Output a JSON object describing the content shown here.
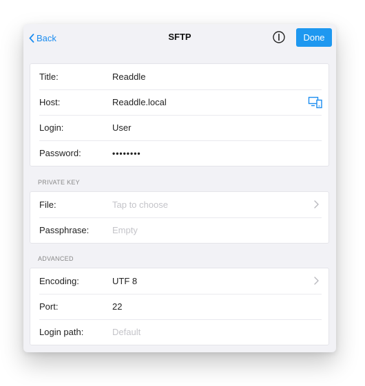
{
  "navbar": {
    "back_label": "Back",
    "title": "SFTP",
    "done_label": "Done",
    "accent_color": "#1e98f0"
  },
  "connection": {
    "title_label": "Title:",
    "title_value": "Readdle",
    "host_label": "Host:",
    "host_value": "Readdle.local",
    "login_label": "Login:",
    "login_value": "User",
    "password_label": "Password:",
    "password_value": "••••••••"
  },
  "private_key": {
    "header": "PRIVATE KEY",
    "file_label": "File:",
    "file_placeholder": "Tap to choose",
    "passphrase_label": "Passphrase:",
    "passphrase_placeholder": "Empty"
  },
  "advanced": {
    "header": "ADVANCED",
    "encoding_label": "Encoding:",
    "encoding_value": "UTF 8",
    "port_label": "Port:",
    "port_value": "22",
    "login_path_label": "Login path:",
    "login_path_placeholder": "Default"
  },
  "icons": {
    "back": "chevron-left-icon",
    "info": "info-icon",
    "devices": "devices-icon",
    "disclosure": "chevron-right-icon"
  }
}
